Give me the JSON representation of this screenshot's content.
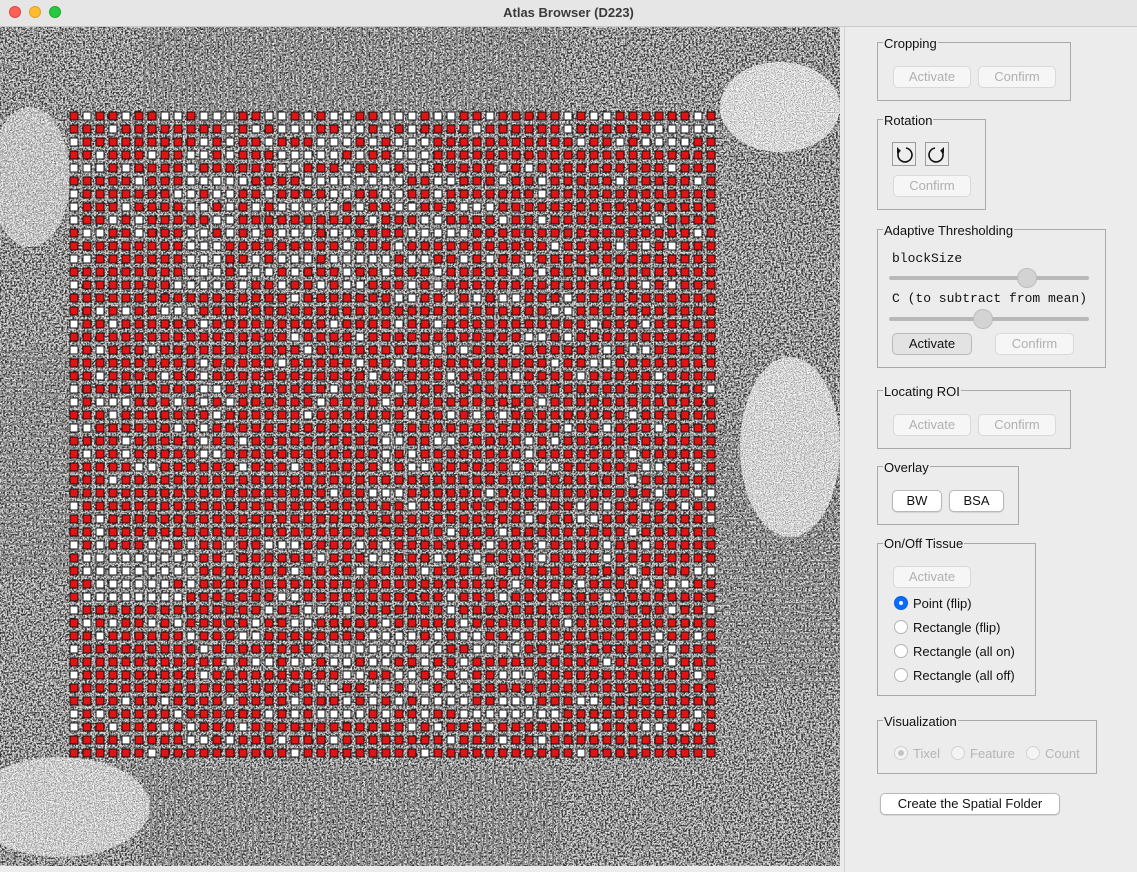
{
  "window": {
    "title": "Atlas Browser (D223)"
  },
  "canvas": {
    "image_description_name": "tissue-image",
    "on_color": "#e01414",
    "off_color": "#ffffff",
    "tixel_border": "#111111"
  },
  "panel": {
    "cropping": {
      "label": "Cropping",
      "activate": "Activate",
      "confirm": "Confirm"
    },
    "rotation": {
      "label": "Rotation",
      "confirm": "Confirm"
    },
    "thresholding": {
      "label": "Adaptive Thresholding",
      "block_size_label": "blockSize",
      "c_label": "C (to subtract from mean)",
      "block_size_level": 0.69,
      "c_level": 0.47,
      "activate": "Activate",
      "confirm": "Confirm"
    },
    "roi": {
      "label": "Locating ROI",
      "activate": "Activate",
      "confirm": "Confirm"
    },
    "overlay": {
      "label": "Overlay",
      "bw": "BW",
      "bsa": "BSA"
    },
    "tissue": {
      "label": "On/Off Tissue",
      "activate": "Activate",
      "options": [
        "Point (flip)",
        "Rectangle (flip)",
        "Rectangle (all on)",
        "Rectangle (all off)"
      ],
      "selected": "Point (flip)"
    },
    "visualization": {
      "label": "Visualization",
      "options": [
        "Tixel",
        "Feature",
        "Count"
      ],
      "selected": "Tixel"
    },
    "create_button": "Create the Spatial Folder"
  }
}
